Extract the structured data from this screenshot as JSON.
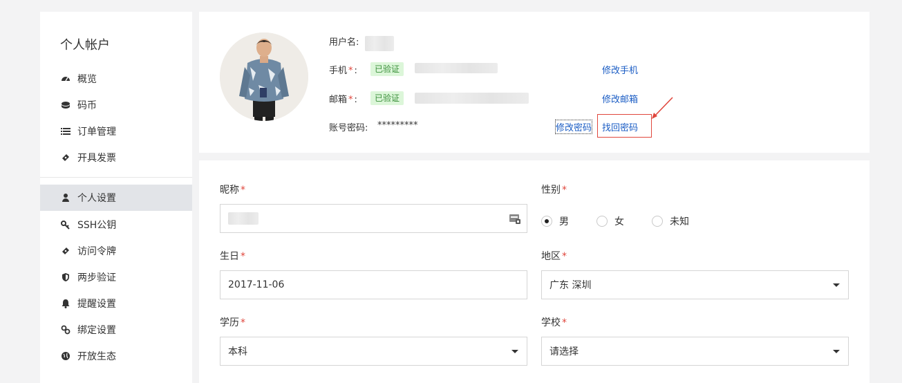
{
  "sidebar": {
    "title": "个人帐户",
    "items": [
      {
        "label": "概览",
        "icon": "dashboard-icon"
      },
      {
        "label": "码币",
        "icon": "coin-icon"
      },
      {
        "label": "订单管理",
        "icon": "list-icon"
      },
      {
        "label": "开具发票",
        "icon": "ticket-icon"
      },
      {
        "label": "个人设置",
        "icon": "user-icon",
        "active": true
      },
      {
        "label": "SSH公钥",
        "icon": "key-icon"
      },
      {
        "label": "访问令牌",
        "icon": "token-icon"
      },
      {
        "label": "两步验证",
        "icon": "shield-icon"
      },
      {
        "label": "提醒设置",
        "icon": "bell-icon"
      },
      {
        "label": "绑定设置",
        "icon": "link-icon"
      },
      {
        "label": "开放生态",
        "icon": "globe-icon"
      }
    ]
  },
  "profile": {
    "username_label": "用户名:",
    "phone_label": "手机",
    "email_label": "邮箱",
    "required_mark": "*",
    "colon": ":",
    "verified": "已验证",
    "password_label": "账号密码:",
    "password_value": "*********",
    "edit_phone": "修改手机",
    "edit_email": "修改邮箱",
    "edit_password": "修改密码",
    "recover_password": "找回密码"
  },
  "form": {
    "nickname_label": "昵称",
    "gender_label": "性别",
    "gender_options": [
      "男",
      "女",
      "未知"
    ],
    "gender_selected": "男",
    "birthday_label": "生日",
    "birthday_value": "2017-11-06",
    "region_label": "地区",
    "region_value": "广东 深圳",
    "education_label": "学历",
    "education_value": "本科",
    "school_label": "学校",
    "school_value": "请选择"
  },
  "colors": {
    "accent_link": "#1a5cc4",
    "required": "#e0463c",
    "verified_bg": "#dcf6d9",
    "verified_text": "#3a8f3a",
    "active_nav_bg": "#e2e4e8"
  }
}
